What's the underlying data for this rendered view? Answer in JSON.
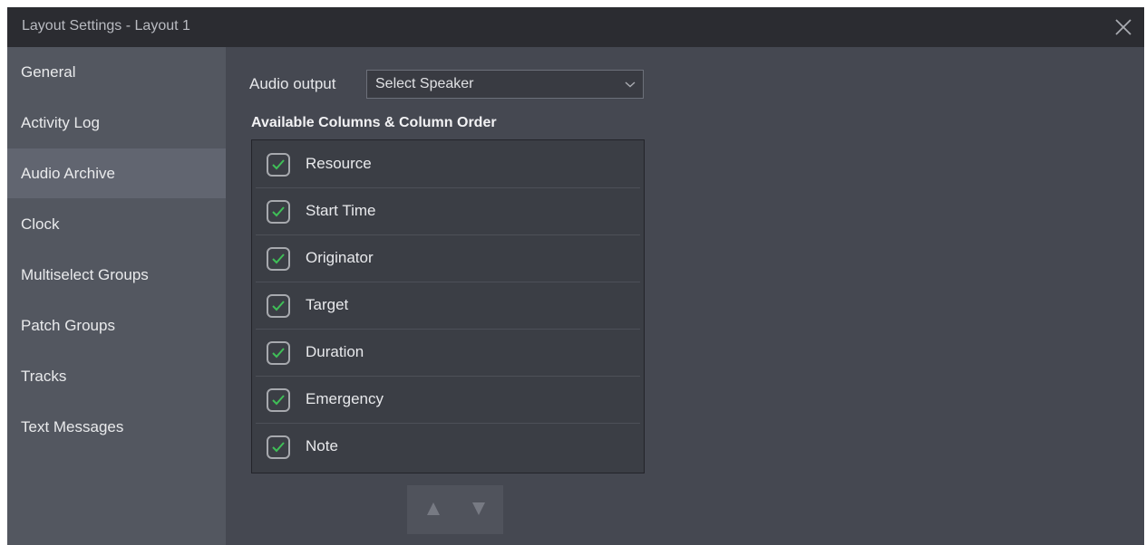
{
  "window": {
    "title": "Layout Settings - Layout 1"
  },
  "sidebar": {
    "items": [
      {
        "label": "General"
      },
      {
        "label": "Activity Log"
      },
      {
        "label": "Audio Archive"
      },
      {
        "label": "Clock"
      },
      {
        "label": "Multiselect Groups"
      },
      {
        "label": "Patch Groups"
      },
      {
        "label": "Tracks"
      },
      {
        "label": "Text Messages"
      }
    ],
    "active": "Audio Archive"
  },
  "audio_output": {
    "label": "Audio output",
    "selected": "Select Speaker"
  },
  "columns": {
    "title": "Available Columns & Column Order",
    "items": [
      {
        "label": "Resource",
        "checked": true
      },
      {
        "label": "Start Time",
        "checked": true
      },
      {
        "label": "Originator",
        "checked": true
      },
      {
        "label": "Target",
        "checked": true
      },
      {
        "label": "Duration",
        "checked": true
      },
      {
        "label": "Emergency",
        "checked": true
      },
      {
        "label": "Note",
        "checked": true
      }
    ]
  },
  "icons": {
    "close": "close-icon",
    "dropdown": "chevron-down-icon",
    "check": "checkmark-icon",
    "move_up": "triangle-up-icon",
    "move_down": "triangle-down-icon"
  },
  "colors": {
    "check_accent": "#3fbf57",
    "titlebar": "#2b2c31",
    "sidebar": "#535760",
    "sidebar_active": "#616570",
    "content": "#454851"
  }
}
